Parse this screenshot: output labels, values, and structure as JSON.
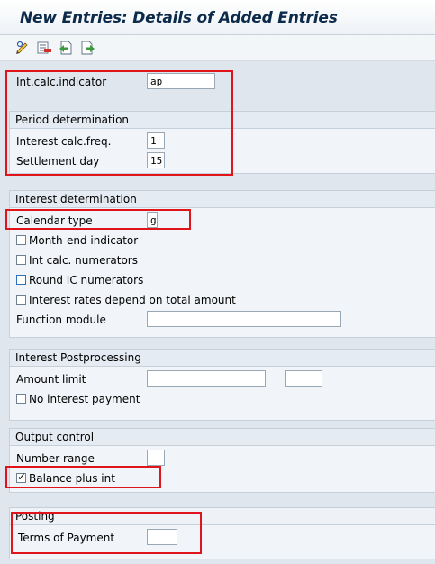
{
  "window": {
    "title": "New Entries: Details of Added Entries"
  },
  "toolbar": {
    "icons": [
      "display-change-icon",
      "delete-icon",
      "previous-entry-icon",
      "next-entry-icon"
    ]
  },
  "header_fields": {
    "int_calc_indicator": {
      "label": "Int.calc.indicator",
      "value": "ap"
    }
  },
  "period_determination": {
    "title": "Period determination",
    "interest_calc_freq": {
      "label": "Interest calc.freq.",
      "value": "1"
    },
    "settlement_day": {
      "label": "Settlement day",
      "value": "15"
    }
  },
  "interest_determination": {
    "title": "Interest determination",
    "calendar_type": {
      "label": "Calendar type",
      "value": "g"
    },
    "month_end_indicator": {
      "label": "Month-end indicator",
      "checked": false
    },
    "int_calc_numerators": {
      "label": "Int calc. numerators",
      "checked": false
    },
    "round_ic_numerators": {
      "label": "Round IC numerators",
      "checked": false
    },
    "interest_rates_total": {
      "label": "Interest rates depend on total amount",
      "checked": false
    },
    "function_module": {
      "label": "Function module",
      "value": ""
    }
  },
  "interest_postprocessing": {
    "title": "Interest Postprocessing",
    "amount_limit": {
      "label": "Amount limit",
      "value": "",
      "currency": ""
    },
    "no_interest_payment": {
      "label": "No interest payment",
      "checked": false
    }
  },
  "output_control": {
    "title": "Output control",
    "number_range": {
      "label": "Number range",
      "value": ""
    },
    "balance_plus_int": {
      "label": "Balance plus int",
      "checked": true
    }
  },
  "posting": {
    "title": "Posting",
    "terms_of_payment": {
      "label": "Terms of Payment",
      "value": ""
    }
  },
  "colors": {
    "highlight": "#e0151b",
    "title_text": "#0c2a4a"
  }
}
